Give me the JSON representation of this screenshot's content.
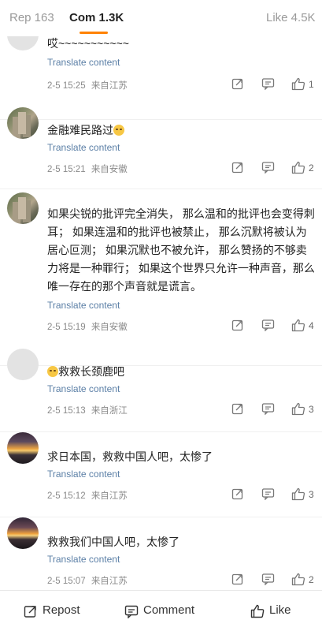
{
  "tabs": {
    "repost": "Rep 163",
    "comment": "Com 1.3K",
    "like": "Like 4.5K"
  },
  "colors": {
    "accent": "#ff8200",
    "link": "#5b7fa6"
  },
  "comments": [
    {
      "text": "哎~~~~~~~~~~~",
      "translate": "Translate content",
      "time": "2-5 15:25",
      "location": "来自江苏",
      "likes": "1",
      "avatar": "grey"
    },
    {
      "text": "金融难民路过",
      "emoji": "crying-face",
      "translate": "Translate content",
      "time": "2-5 15:21",
      "location": "来自安徽",
      "likes": "2",
      "avatar": "building"
    },
    {
      "text": "如果尖锐的批评完全消失， 那么温和的批评也会变得刺耳； 如果连温和的批评也被禁止， 那么沉默将被认为居心叵测； 如果沉默也不被允许， 那么赞扬的不够卖力将是一种罪行； 如果这个世界只允许一种声音，那么唯一存在的那个声音就是谎言。",
      "translate": "Translate content",
      "time": "2-5 15:19",
      "location": "来自安徽",
      "likes": "4",
      "avatar": "building"
    },
    {
      "text": "救救长颈鹿吧",
      "emoji": "crying-face",
      "translate": "Translate content",
      "time": "2-5 15:13",
      "location": "来自浙江",
      "likes": "3",
      "avatar": "grey"
    },
    {
      "text": "求日本国，救救中国人吧，太惨了",
      "translate": "Translate content",
      "time": "2-5 15:12",
      "location": "来自江苏",
      "likes": "3",
      "avatar": "sunset"
    },
    {
      "text": "救救我们中国人吧，太惨了",
      "translate": "Translate content",
      "time": "2-5 15:07",
      "location": "来自江苏",
      "likes": "2",
      "avatar": "sunset2"
    }
  ],
  "bottom": {
    "repost": "Repost",
    "comment": "Comment",
    "like": "Like"
  }
}
